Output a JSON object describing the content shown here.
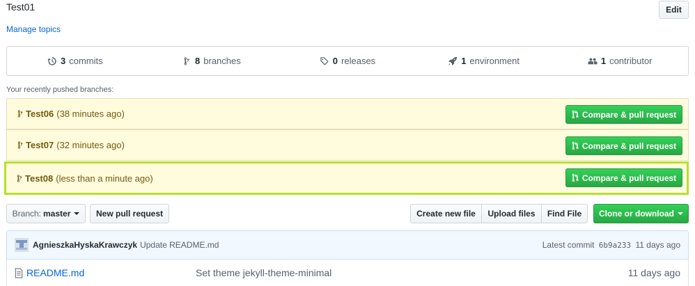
{
  "repo": {
    "description": "Test01",
    "manage_topics": "Manage topics",
    "edit_label": "Edit"
  },
  "summary": {
    "commits": {
      "count": "3",
      "label": "commits",
      "icon": "history-icon"
    },
    "branches": {
      "count": "8",
      "label": "branches",
      "icon": "branch-icon"
    },
    "releases": {
      "count": "0",
      "label": "releases",
      "icon": "tag-icon"
    },
    "environment": {
      "count": "1",
      "label": "environment",
      "icon": "rocket-icon"
    },
    "contributors": {
      "count": "1",
      "label": "contributor",
      "icon": "people-icon"
    }
  },
  "recent": {
    "label": "Your recently pushed branches:",
    "compare_label": "Compare & pull request",
    "branches": [
      {
        "name": "Test06",
        "time": "(38 minutes ago)"
      },
      {
        "name": "Test07",
        "time": "(32 minutes ago)"
      },
      {
        "name": "Test08",
        "time": "(less than a minute ago)"
      }
    ]
  },
  "toolbar": {
    "branch_label": "Branch:",
    "branch_value": "master",
    "new_pr": "New pull request",
    "create_file": "Create new file",
    "upload_files": "Upload files",
    "find_file": "Find File",
    "clone": "Clone or download"
  },
  "latest_commit": {
    "author": "AgnieszkaHyskaKrawczyk",
    "message": "Update README.md",
    "prefix": "Latest commit",
    "sha": "6b9a233",
    "age": "11 days ago"
  },
  "files": [
    {
      "name": "README.md",
      "message": "Set theme jekyll-theme-minimal",
      "age": "11 days ago"
    }
  ],
  "colors": {
    "link": "#0366d6",
    "green": "#28a745",
    "highlight_border": "#b8e02c",
    "branch_bg": "#fffbdd"
  }
}
